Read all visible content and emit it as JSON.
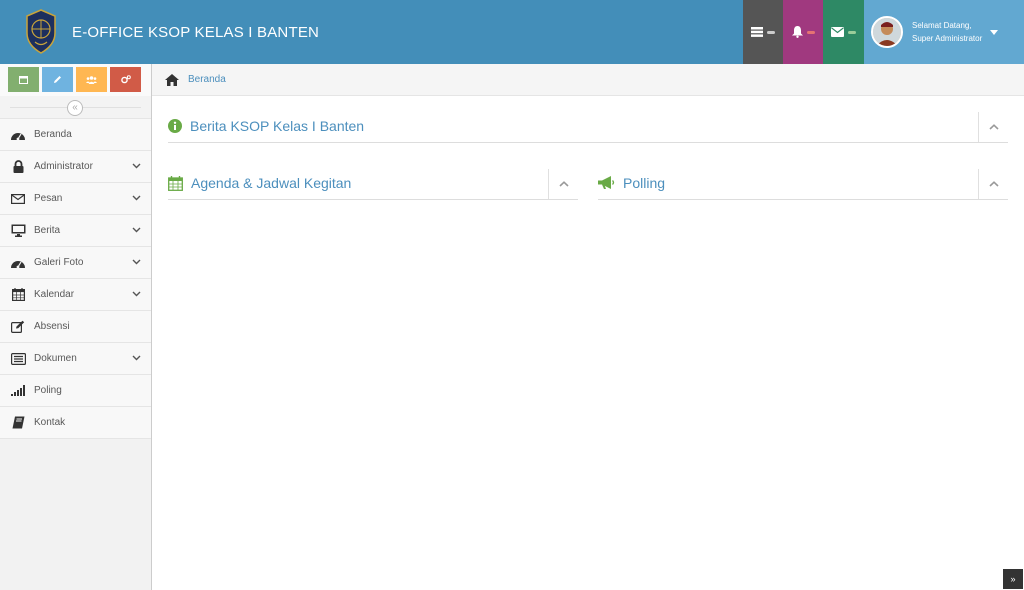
{
  "header": {
    "title": "E-OFFICE KSOP KELAS I BANTEN",
    "user_greeting": "Selamat Datang,",
    "user_name": "Super Administrator",
    "colors": {
      "navbar": "#438eb9",
      "tasks": "#555555",
      "notifications": "#a0397f",
      "messages": "#2e8965",
      "user": "#62a8d1"
    }
  },
  "shortcuts": [
    {
      "icon": "calendar-icon",
      "color": "#82af6f"
    },
    {
      "icon": "pencil-icon",
      "color": "#6fb3e0"
    },
    {
      "icon": "users-icon",
      "color": "#ffb752"
    },
    {
      "icon": "cogs-icon",
      "color": "#d15b47"
    }
  ],
  "sidebar": {
    "collapse_symbol": "«",
    "items": [
      {
        "label": "Beranda",
        "icon": "dashboard-icon",
        "has_submenu": false
      },
      {
        "label": "Administrator",
        "icon": "lock-icon",
        "has_submenu": true
      },
      {
        "label": "Pesan",
        "icon": "envelope-icon",
        "has_submenu": true
      },
      {
        "label": "Berita",
        "icon": "desktop-icon",
        "has_submenu": true
      },
      {
        "label": "Galeri Foto",
        "icon": "dashboard-icon",
        "has_submenu": true
      },
      {
        "label": "Kalendar",
        "icon": "calendar-icon",
        "has_submenu": true
      },
      {
        "label": "Absensi",
        "icon": "edit-icon",
        "has_submenu": false
      },
      {
        "label": "Dokumen",
        "icon": "list-icon",
        "has_submenu": true
      },
      {
        "label": "Poling",
        "icon": "signal-icon",
        "has_submenu": false
      },
      {
        "label": "Kontak",
        "icon": "book-icon",
        "has_submenu": false
      }
    ]
  },
  "breadcrumb": {
    "label": "Beranda"
  },
  "widgets": {
    "berita": {
      "title": "Berita KSOP Kelas I Banten",
      "icon": "info-circle-icon"
    },
    "agenda": {
      "title": "Agenda & Jadwal Kegitan",
      "icon": "calendar-icon"
    },
    "polling": {
      "title": "Polling",
      "icon": "bullhorn-icon"
    }
  },
  "scroll_top_symbol": "»"
}
